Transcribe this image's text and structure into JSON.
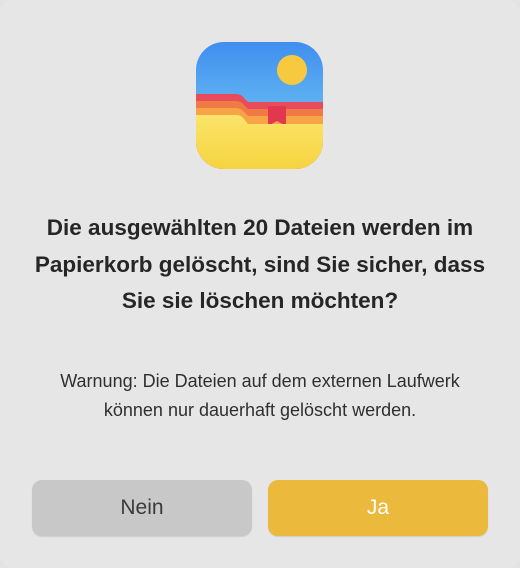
{
  "dialog": {
    "icon": "photo-folder-icon",
    "title": "Die ausgewählten 20 Dateien werden im Papierkorb gelöscht, sind Sie sicher, dass Sie sie löschen möchten?",
    "message": "Warnung: Die Dateien auf dem externen Laufwerk können nur dauerhaft gelöscht werden.",
    "buttons": {
      "no_label": "Nein",
      "yes_label": "Ja"
    }
  },
  "colors": {
    "dialog_background": "#e6e6e6",
    "secondary_button": "#c8c8c8",
    "primary_button": "#ebba3d",
    "icon_sky": "#4a90e8",
    "icon_sun": "#f6c93f",
    "icon_folder": "#f7d84e"
  }
}
